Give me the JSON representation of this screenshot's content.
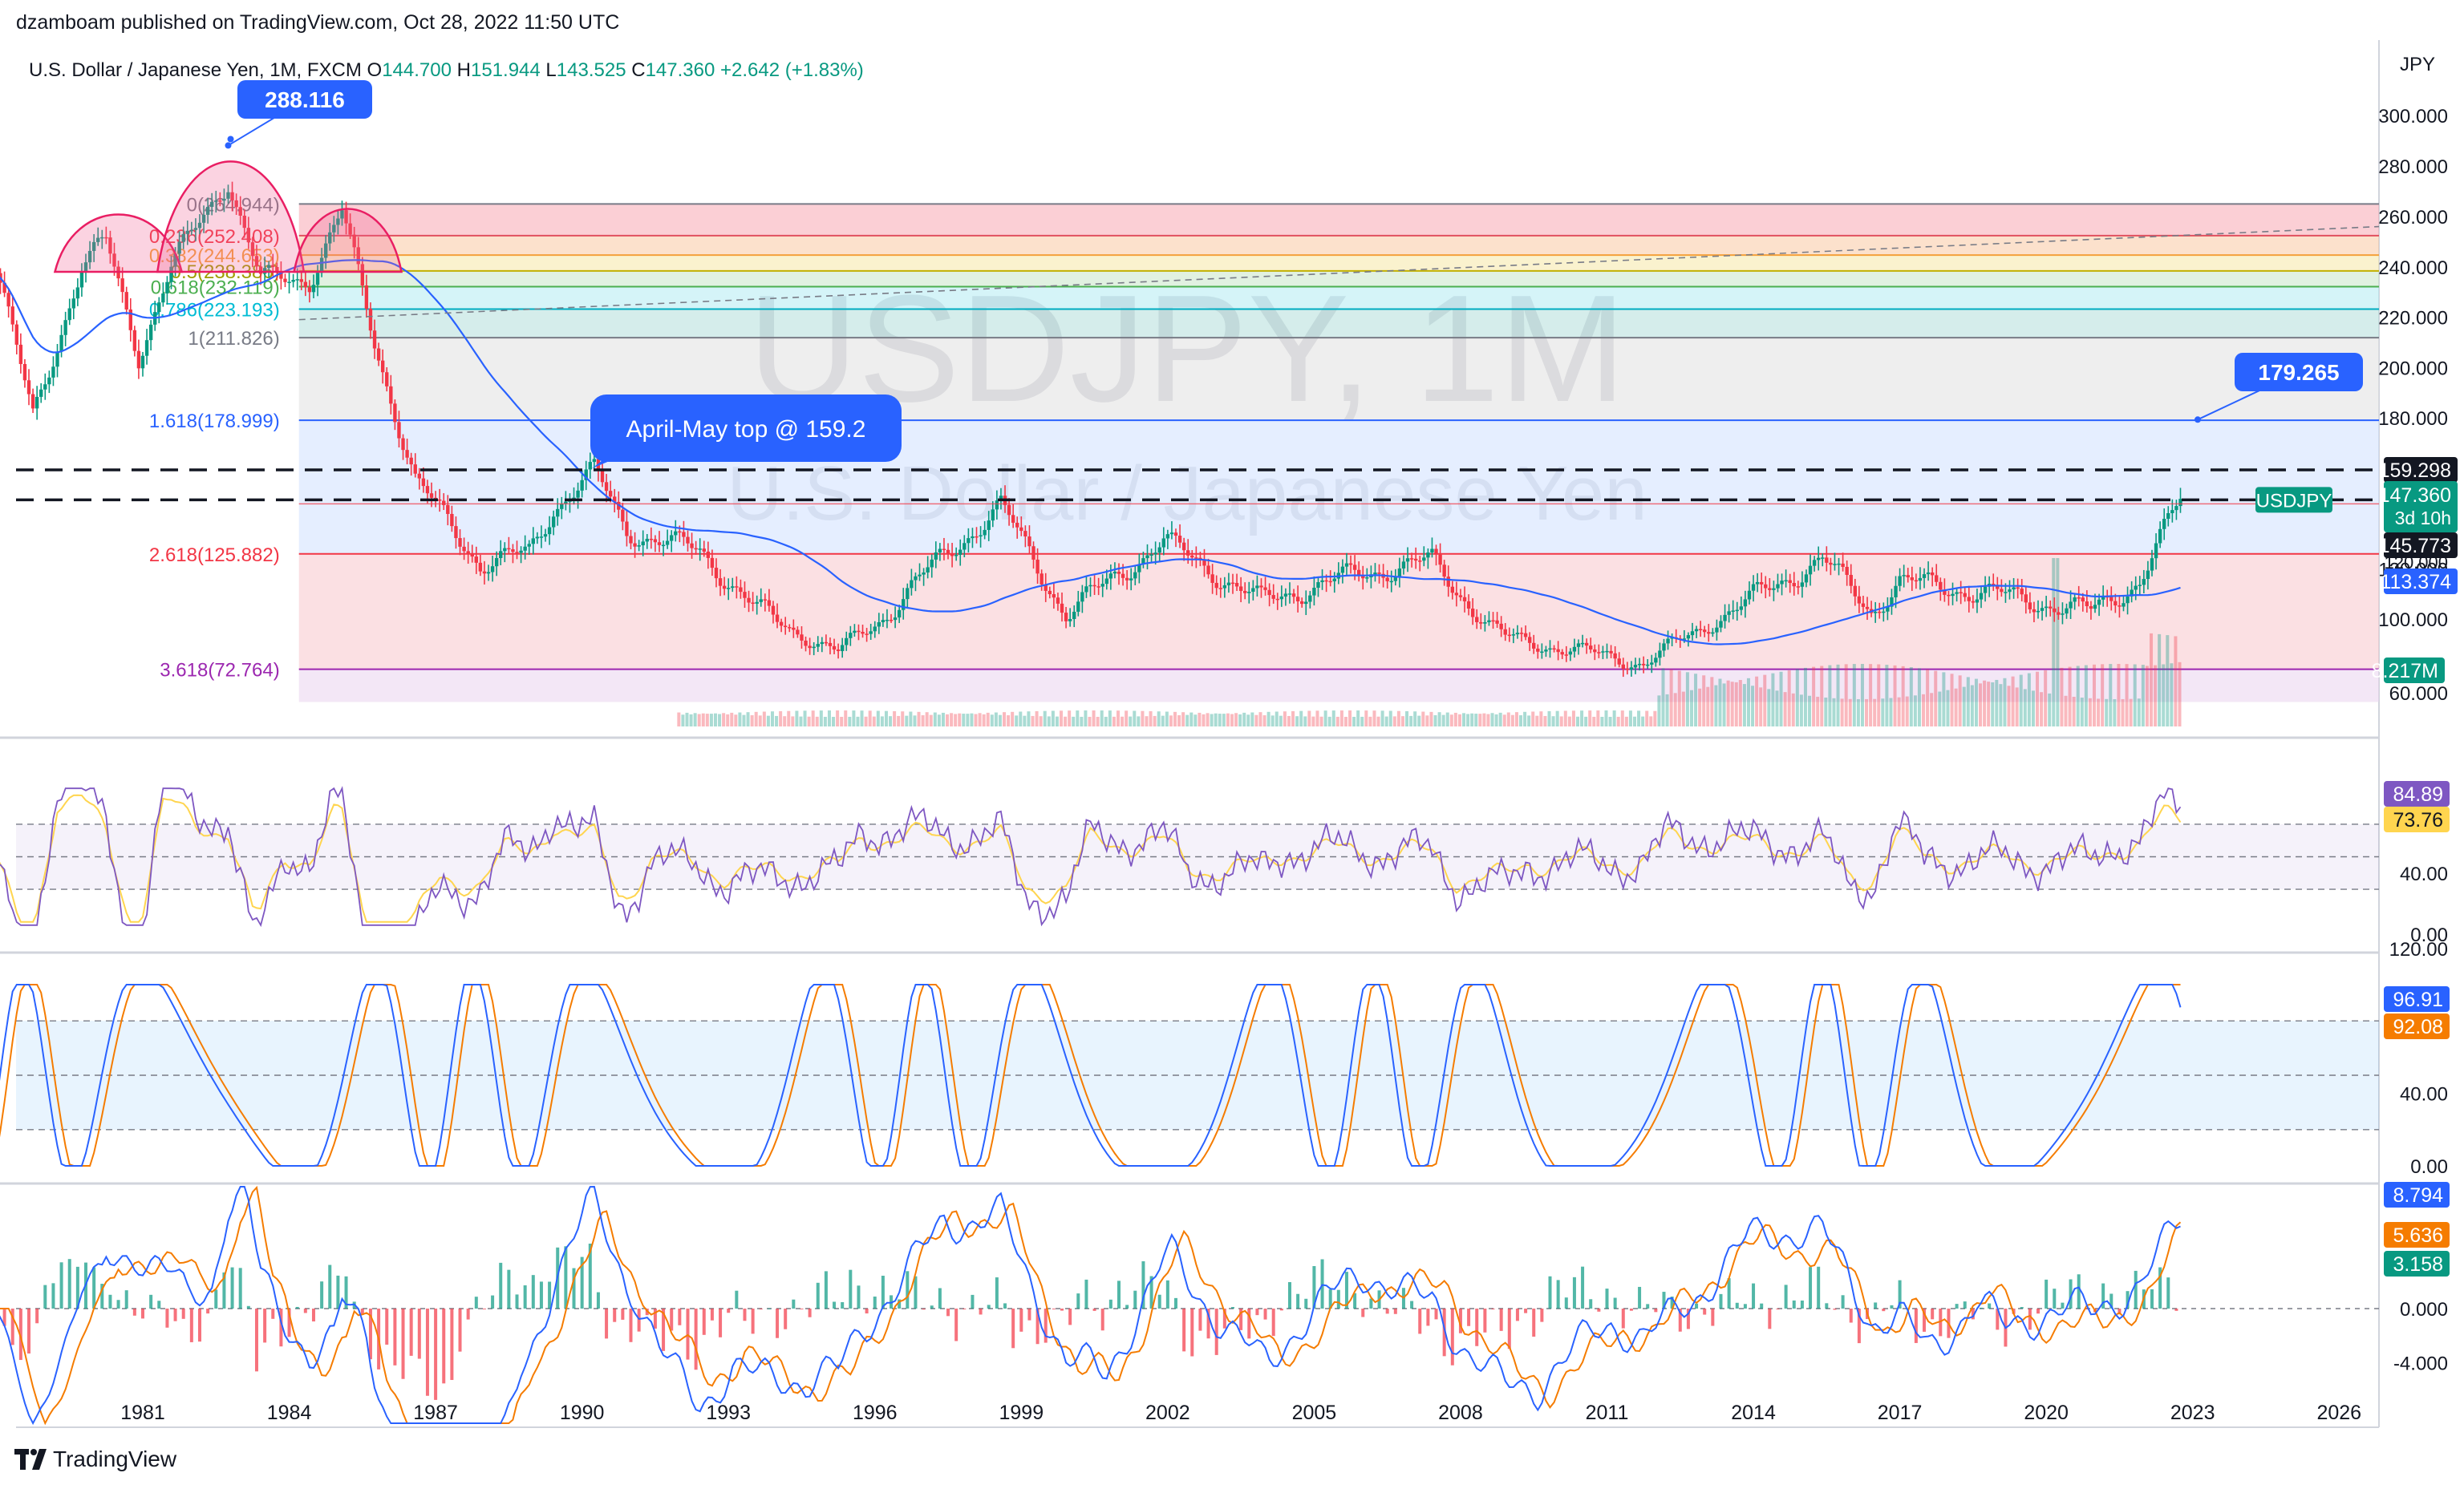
{
  "header": {
    "published": "dzamboam published on TradingView.com, Oct 28, 2022 11:50 UTC",
    "symbol_line": {
      "name": "U.S. Dollar / Japanese Yen, 1M, FXCM",
      "o_label": "O",
      "o": "144.700",
      "h_label": "H",
      "h": "151.944",
      "l_label": "L",
      "l": "143.525",
      "c_label": "C",
      "c": "147.360",
      "change": "+2.642 (+1.83%)"
    }
  },
  "watermark": {
    "ticker": "USDJPY, 1M",
    "name": "U.S. Dollar / Japanese Yen"
  },
  "footer": {
    "brand": "TradingView"
  },
  "colors": {
    "up": "#089981",
    "down": "#f23645",
    "ma": "#2962ff",
    "signal": "#f57c00",
    "rsi": "#7e57c2",
    "rsi_ma": "#ffd54f"
  },
  "chart_data": [
    {
      "type": "candlestick",
      "panel": "price",
      "currency_label": "JPY",
      "y_ticks": [
        "300.000",
        "280.000",
        "260.000",
        "240.000",
        "220.000",
        "200.000",
        "180.000",
        "160.000",
        "140.000",
        "120.000",
        "100.000",
        "60.000"
      ],
      "x_ticks": [
        "1981",
        "1984",
        "1987",
        "1990",
        "1993",
        "1996",
        "1999",
        "2002",
        "2005",
        "2008",
        "2011",
        "2014",
        "2017",
        "2020",
        "2023",
        "2026"
      ],
      "fib_levels": [
        {
          "ratio": "0",
          "label": "0(264.944)",
          "value": 264.944
        },
        {
          "ratio": "0.236",
          "label": "0.236(252.408)",
          "value": 252.408
        },
        {
          "ratio": "0.382",
          "label": "0.382(244.653)",
          "value": 244.653
        },
        {
          "ratio": "0.5",
          "label": "0.5(238.386)",
          "value": 238.386
        },
        {
          "ratio": "0.618",
          "label": "0.618(232.119)",
          "value": 232.119
        },
        {
          "ratio": "0.786",
          "label": "0.786(223.193)",
          "value": 223.193
        },
        {
          "ratio": "1",
          "label": "1(211.826)",
          "value": 211.826
        },
        {
          "ratio": "1.618",
          "label": "1.618(178.999)",
          "value": 178.999
        },
        {
          "ratio": "2.618",
          "label": "2.618(125.882)",
          "value": 125.882
        },
        {
          "ratio": "3.618",
          "label": "3.618(72.764)",
          "value": 72.764
        }
      ],
      "annotations": [
        {
          "text": "288.116",
          "value": 288.116
        },
        {
          "text": "179.265",
          "value": 179.265
        },
        {
          "text": "April-May top @ 159.2",
          "value": 159.2
        }
      ],
      "dashed_levels": [
        159.298,
        147.36
      ],
      "price_labels": [
        {
          "text": "159.298",
          "kind": "level"
        },
        {
          "text": "USDJPY",
          "kind": "symbol"
        },
        {
          "text": "147.360",
          "kind": "last"
        },
        {
          "text": "3d 10h",
          "kind": "countdown"
        },
        {
          "text": "145.773",
          "kind": "level"
        },
        {
          "text": "120.000",
          "kind": "tick"
        },
        {
          "text": "113.374",
          "kind": "ma"
        },
        {
          "text": "8.217M",
          "kind": "volume"
        }
      ],
      "approx_closes": [
        {
          "date": "1978-01",
          "close": 240
        },
        {
          "date": "1978-10",
          "close": 180
        },
        {
          "date": "1979-10",
          "close": 240
        },
        {
          "date": "1980-04",
          "close": 250
        },
        {
          "date": "1980-12",
          "close": 205
        },
        {
          "date": "1981-08",
          "close": 240
        },
        {
          "date": "1982-10",
          "close": 275
        },
        {
          "date": "1983-06",
          "close": 235
        },
        {
          "date": "1984-06",
          "close": 235
        },
        {
          "date": "1985-02",
          "close": 262
        },
        {
          "date": "1985-10",
          "close": 210
        },
        {
          "date": "1986-08",
          "close": 155
        },
        {
          "date": "1987-12",
          "close": 122
        },
        {
          "date": "1988-12",
          "close": 126
        },
        {
          "date": "1989-06",
          "close": 144
        },
        {
          "date": "1990-04",
          "close": 159
        },
        {
          "date": "1990-12",
          "close": 135
        },
        {
          "date": "1992-06",
          "close": 127
        },
        {
          "date": "1993-08",
          "close": 104
        },
        {
          "date": "1995-04",
          "close": 82
        },
        {
          "date": "1996-12",
          "close": 116
        },
        {
          "date": "1998-08",
          "close": 145
        },
        {
          "date": "1999-12",
          "close": 102
        },
        {
          "date": "2001-12",
          "close": 131
        },
        {
          "date": "2003-12",
          "close": 107
        },
        {
          "date": "2005-12",
          "close": 118
        },
        {
          "date": "2007-06",
          "close": 123
        },
        {
          "date": "2008-12",
          "close": 90
        },
        {
          "date": "2011-10",
          "close": 76
        },
        {
          "date": "2013-05",
          "close": 101
        },
        {
          "date": "2015-06",
          "close": 124
        },
        {
          "date": "2016-06",
          "close": 103
        },
        {
          "date": "2017-01",
          "close": 115
        },
        {
          "date": "2018-12",
          "close": 110
        },
        {
          "date": "2020-12",
          "close": 103
        },
        {
          "date": "2021-12",
          "close": 115
        },
        {
          "date": "2022-10",
          "close": 147.36
        }
      ]
    },
    {
      "type": "line",
      "panel": "rsi",
      "y_ticks": [
        "40.00",
        "0.00"
      ],
      "labels": [
        {
          "text": "84.89"
        },
        {
          "text": "73.76"
        }
      ],
      "bands": [
        70,
        30
      ]
    },
    {
      "type": "line",
      "panel": "stochastic",
      "y_ticks": [
        "120.00",
        "40.00",
        "0.00"
      ],
      "labels": [
        {
          "text": "96.91"
        },
        {
          "text": "92.08"
        }
      ],
      "bands": [
        80,
        20
      ]
    },
    {
      "type": "bar",
      "panel": "macd",
      "y_ticks": [
        "0.000",
        "-4.000"
      ],
      "labels": [
        {
          "text": "8.794"
        },
        {
          "text": "5.636"
        },
        {
          "text": "3.158"
        }
      ]
    }
  ]
}
